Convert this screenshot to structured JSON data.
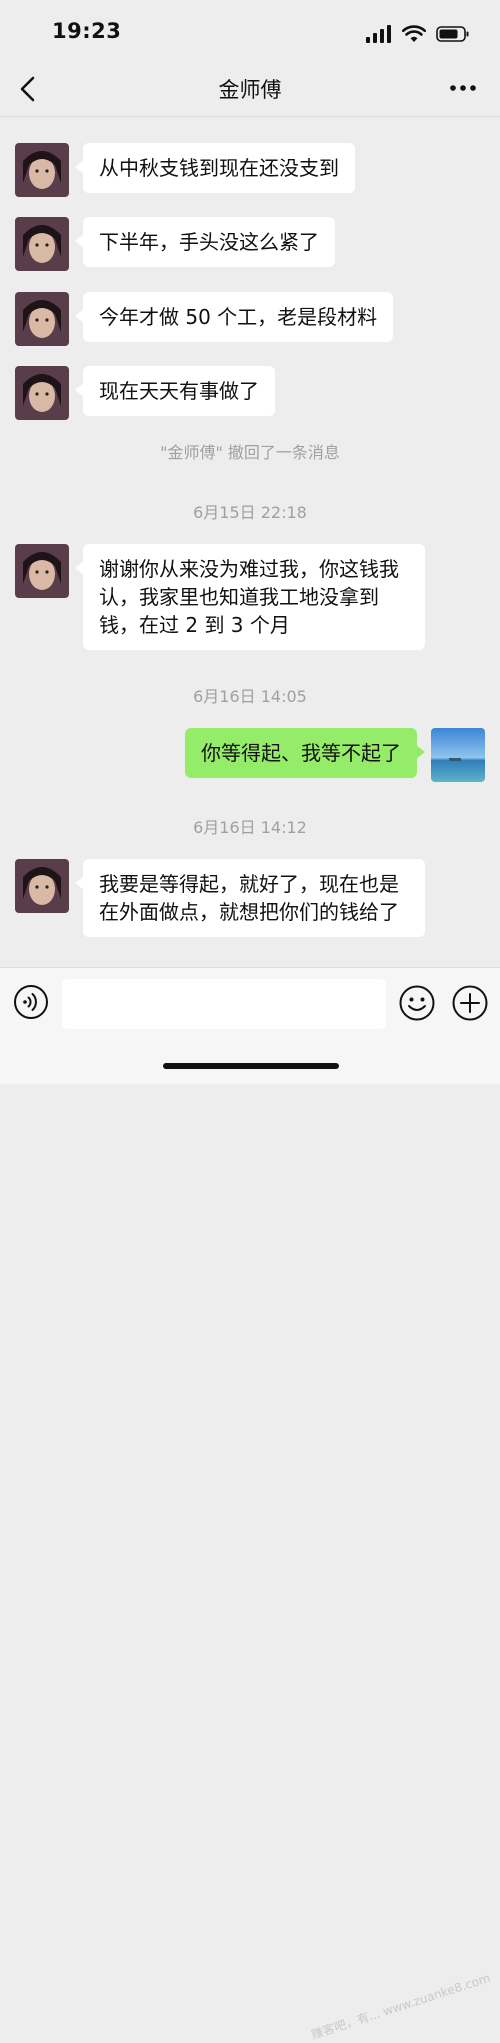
{
  "status_bar": {
    "time": "19:23"
  },
  "nav": {
    "title": "金师傅"
  },
  "messages": [
    {
      "side": "in",
      "text": "从中秋支钱到现在还没支到"
    },
    {
      "side": "in",
      "text": "下半年，手头没这么紧了"
    },
    {
      "side": "in",
      "text": "今年才做 50 个工，老是段材料"
    },
    {
      "side": "in",
      "text": "现在天天有事做了"
    },
    {
      "side": "out",
      "text": "你等得起、我等不起了"
    },
    {
      "side": "in",
      "text": "谢谢你从来没为难过我，你这钱我认，我家里也知道我工地没拿到钱，在过 2 到 3 个月"
    },
    {
      "side": "in",
      "text": "我要是等得起，就好了，现在也是在外面做点，就想把你们的钱给了"
    }
  ],
  "system": {
    "recall": "\"金师傅\" 撤回了一条消息",
    "time1": "6月15日 22:18",
    "time2": "6月16日 14:05",
    "time3": "6月16日 14:12"
  },
  "input": {
    "placeholder": ""
  },
  "watermark": "赚客吧，有... www.zuanke8.com",
  "colors": {
    "background": "#ededed",
    "incoming_bubble": "#ffffff",
    "outgoing_bubble": "#95ec69"
  },
  "icons": [
    "back-arrow-icon",
    "more-dots-icon",
    "voice-icon",
    "emoji-icon",
    "plus-icon"
  ]
}
